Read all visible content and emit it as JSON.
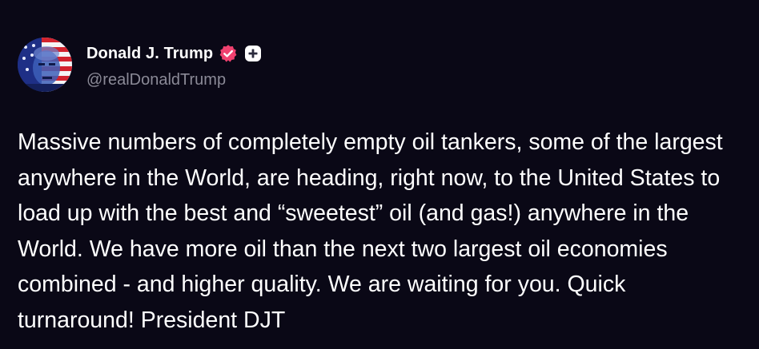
{
  "author": {
    "display_name": "Donald J. Trump",
    "handle": "@realDonaldTrump",
    "verified_icon": "verified-check-icon",
    "add_icon": "plus-icon",
    "badge_color": "#f0416f"
  },
  "post": {
    "text": "Massive numbers of completely empty oil tankers, some of the largest anywhere in the World, are heading, right now, to the United States to load up with the best and “sweetest” oil (and gas!) anywhere in the World. We have more oil than the next two largest oil economies combined - and higher quality. We are waiting for you. Quick turnaround! President DJT"
  },
  "theme": {
    "background": "#0a0816",
    "text": "#ffffff",
    "secondary_text": "#8b8a97"
  }
}
